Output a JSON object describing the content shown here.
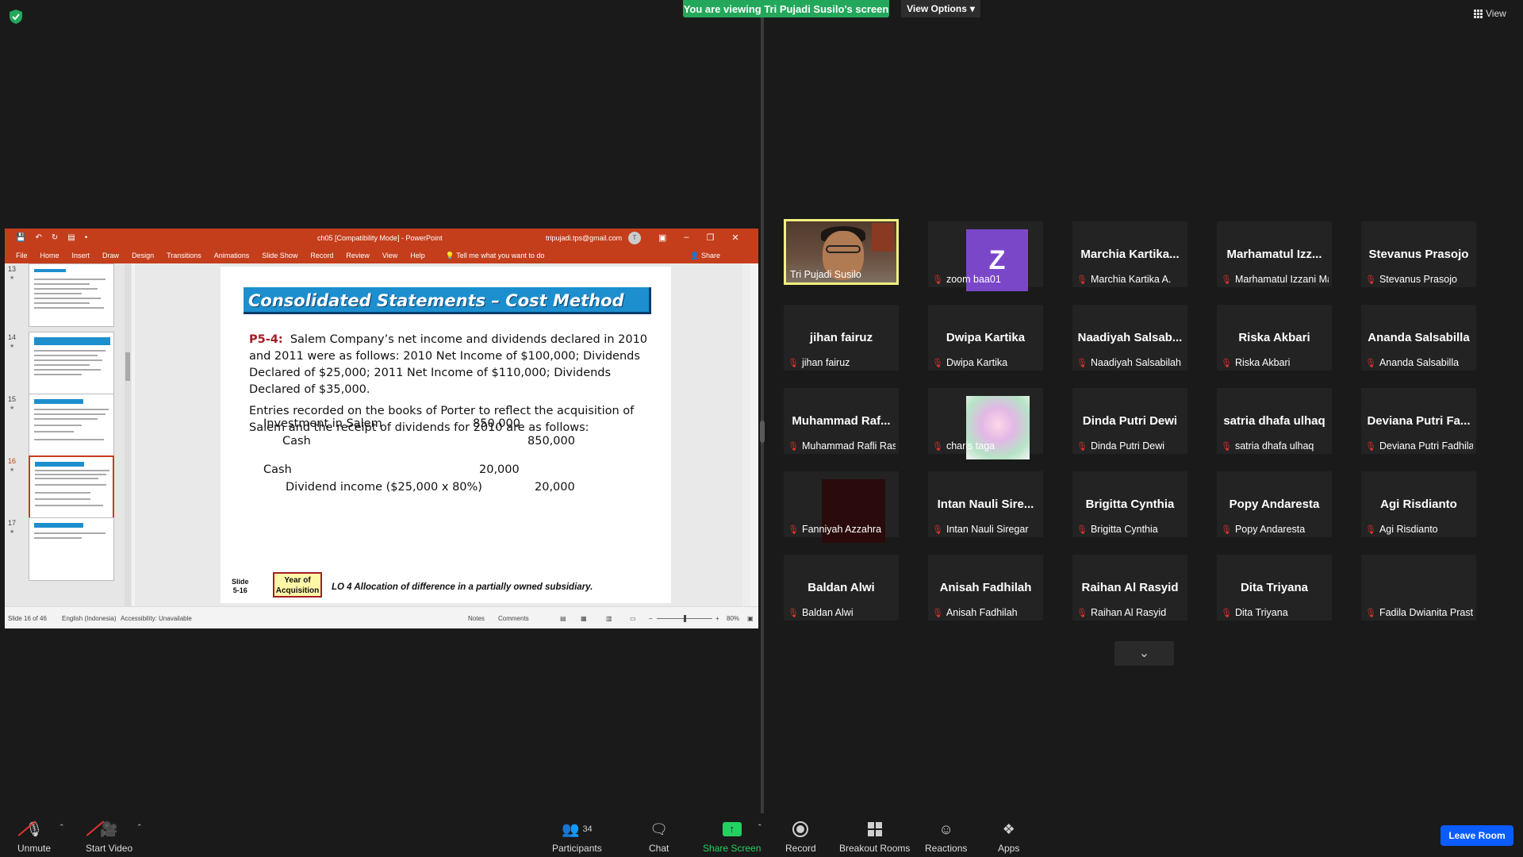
{
  "banner": {
    "viewing": "You are viewing Tri Pujadi Susilo's screen",
    "view_options": "View Options",
    "view": "View"
  },
  "ppt": {
    "doc_title": "ch05 [Compatibility Mode] - PowerPoint",
    "email": "tripujadi.tps@gmail.com",
    "avatar_letter": "T",
    "menu": [
      "File",
      "Home",
      "Insert",
      "Draw",
      "Design",
      "Transitions",
      "Animations",
      "Slide Show",
      "Record",
      "Review",
      "View",
      "Help"
    ],
    "tell_me": "Tell me what you want to do",
    "share": "Share",
    "thumbnails": [
      {
        "num": "13",
        "current": false
      },
      {
        "num": "14",
        "current": false
      },
      {
        "num": "15",
        "current": false
      },
      {
        "num": "16",
        "current": true
      },
      {
        "num": "17",
        "current": false
      }
    ],
    "slide": {
      "title": "Consolidated Statements – Cost Method",
      "problem_label": "P5-4:",
      "problem_text": "Salem Company’s net income and dividends declared in 2010 and 2011 were as follows: 2010 Net Income of $100,000; Dividends Declared of $25,000; 2011 Net Income of $110,000; Dividends Declared of $35,000.",
      "entries_text": "Entries recorded on the books of Porter to reflect the acquisition of Salem and the receipt of dividends for 2010 are as follows:",
      "journal": [
        {
          "account": "Investment in Salem",
          "debit": "850,000",
          "credit": ""
        },
        {
          "account": "Cash",
          "debit": "",
          "credit": "850,000"
        },
        {
          "account": "Cash",
          "debit": "20,000",
          "credit": ""
        },
        {
          "account": "Dividend income  ($25,000 x 80%)",
          "debit": "",
          "credit": "20,000"
        }
      ],
      "slide_label": "Slide",
      "slide_number": "5-16",
      "year_label": "Year of Acquisition",
      "lo_text": "LO 4  Allocation of difference in a partially owned subsidiary."
    },
    "status": {
      "slide_of": "Slide 16 of 46",
      "language": "English (Indonesia)",
      "accessibility": "Accessibility: Unavailable",
      "notes": "Notes",
      "comments": "Comments",
      "zoom": "80%"
    }
  },
  "gallery": [
    {
      "big": "",
      "label": "Tri Pujadi Susilo",
      "muted": false,
      "video": "host"
    },
    {
      "big": "",
      "label": "zoom baa01",
      "muted": true,
      "video": "z"
    },
    {
      "big": "Marchia  Kartika...",
      "label": "Marchia Kartika A.",
      "muted": true
    },
    {
      "big": "Marhamatul  Izz...",
      "label": "Marhamatul Izzani Mauli...",
      "muted": true
    },
    {
      "big": "Stevanus Prasojo",
      "label": "Stevanus Prasojo",
      "muted": true
    },
    {
      "big": "jihan fairuz",
      "label": "jihan fairuz",
      "muted": true
    },
    {
      "big": "Dwipa Kartika",
      "label": "Dwipa Kartika",
      "muted": true
    },
    {
      "big": "Naadiyah  Salsab...",
      "label": "Naadiyah Salsabilah",
      "muted": true
    },
    {
      "big": "Riska Akbari",
      "label": "Riska Akbari",
      "muted": true
    },
    {
      "big": "Ananda Salsabilla",
      "label": "Ananda Salsabilla",
      "muted": true
    },
    {
      "big": "Muhammad  Raf...",
      "label": "Muhammad Rafli Rasyidin",
      "muted": true
    },
    {
      "big": "",
      "label": "charis taga",
      "muted": true,
      "video": "butterfly"
    },
    {
      "big": "Dinda Putri Dewi",
      "label": "Dinda Putri Dewi",
      "muted": true
    },
    {
      "big": "satria dhafa ulhaq",
      "label": "satria dhafa ulhaq",
      "muted": true
    },
    {
      "big": "Deviana  Putri  Fa...",
      "label": "Deviana Putri Fadhilah",
      "muted": true
    },
    {
      "big": "",
      "label": "Fanniyah Azzahra",
      "muted": true,
      "video": "dark"
    },
    {
      "big": "Intan  Nauli  Sire...",
      "label": "Intan Nauli Siregar",
      "muted": true
    },
    {
      "big": "Brigitta Cynthia",
      "label": "Brigitta Cynthia",
      "muted": true
    },
    {
      "big": "Popy Andaresta",
      "label": "Popy Andaresta",
      "muted": true
    },
    {
      "big": "Agi Risdianto",
      "label": "Agi Risdianto",
      "muted": true
    },
    {
      "big": "Baldan Alwi",
      "label": "Baldan Alwi",
      "muted": true
    },
    {
      "big": "Anisah Fadhilah",
      "label": "Anisah Fadhilah",
      "muted": true
    },
    {
      "big": "Raihan Al Rasyid",
      "label": "Raihan Al Rasyid",
      "muted": true
    },
    {
      "big": "Dita Triyana",
      "label": "Dita Triyana",
      "muted": true
    },
    {
      "big": "",
      "label": "Fadila Dwianita Prastantri",
      "muted": true
    }
  ],
  "toolbar": {
    "unmute": "Unmute",
    "start_video": "Start Video",
    "participants": "Participants",
    "participants_count": "34",
    "chat": "Chat",
    "share_screen": "Share Screen",
    "record": "Record",
    "breakout": "Breakout Rooms",
    "reactions": "Reactions",
    "apps": "Apps",
    "leave": "Leave Room"
  },
  "colors": {
    "banner_green": "#23a85b",
    "ppt_red": "#c43e1c",
    "slide_title_blue": "#1d8fce",
    "leave_blue": "#0b5cff",
    "muted_red": "#e0342d",
    "active_speaker_yellow": "#f0ef80"
  }
}
